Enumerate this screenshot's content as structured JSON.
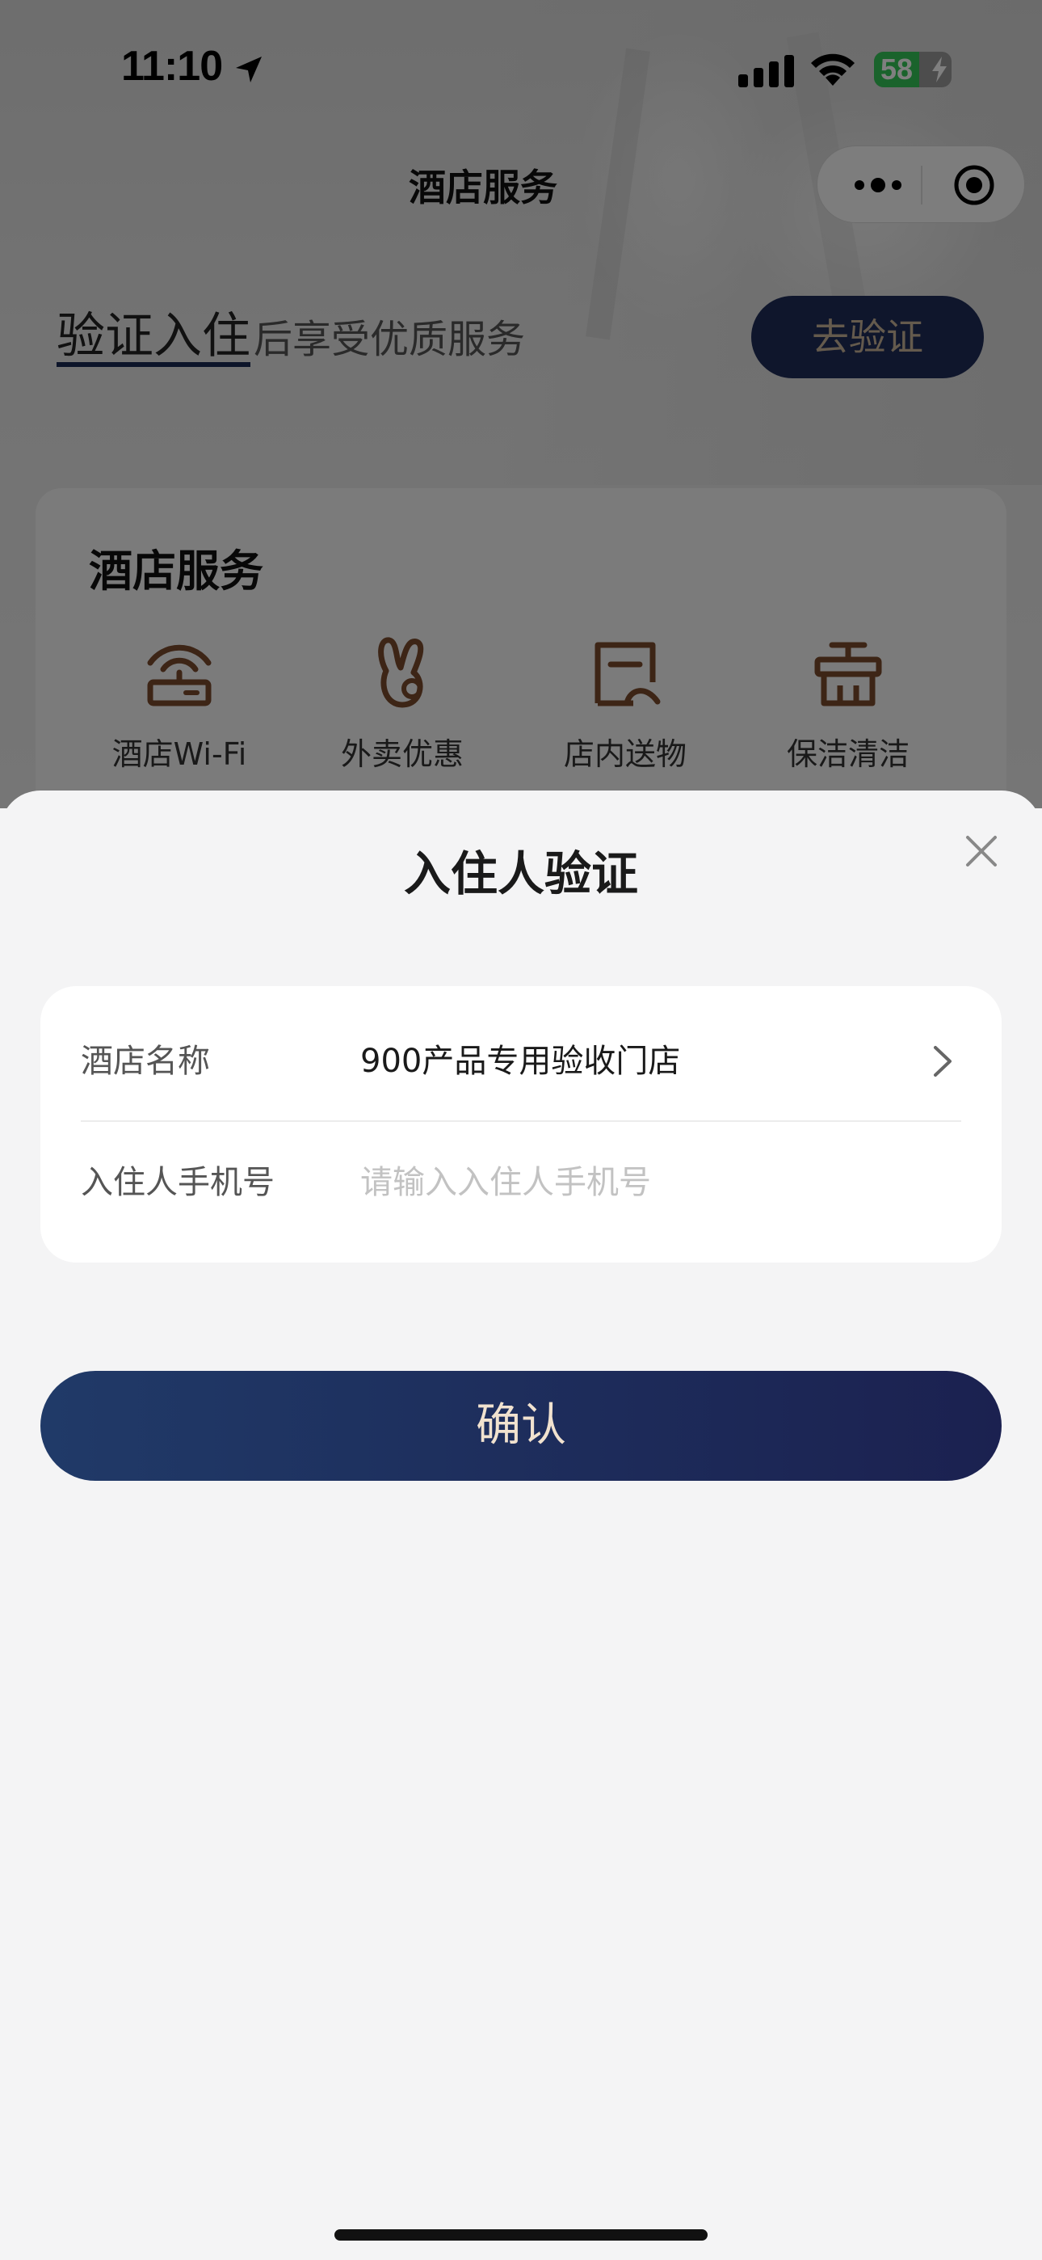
{
  "status_bar": {
    "time": "11:10",
    "battery": "58",
    "battery_level": 0.58,
    "icons": [
      "location-arrow-icon",
      "cellular-signal-icon",
      "wifi-icon",
      "battery-icon",
      "charging-bolt-icon"
    ]
  },
  "nav": {
    "title": "酒店服务",
    "capsule_icons": [
      "more-dots-icon",
      "close-target-icon"
    ]
  },
  "verify_banner": {
    "strong": "验证入住",
    "rest": "后享受优质服务",
    "button": "去验证"
  },
  "services": {
    "title": "酒店服务",
    "items": [
      {
        "label": "酒店Wi-Fi",
        "icon": "wifi-router-icon"
      },
      {
        "label": "外卖优惠",
        "icon": "rabbit-icon"
      },
      {
        "label": "店内送物",
        "icon": "delivery-box-icon"
      },
      {
        "label": "保洁清洁",
        "icon": "cleaning-basket-icon"
      }
    ]
  },
  "sheet": {
    "title": "入住人验证",
    "close_icon": "close-icon",
    "hotel_label": "酒店名称",
    "hotel_value": "900产品专用验收门店",
    "phone_label": "入住人手机号",
    "phone_placeholder": "请输入入住人手机号",
    "phone_value": "",
    "confirm": "确认"
  },
  "colors": {
    "accent_navy": "#1e2d58",
    "button_text_gold": "#f1e2cf",
    "icon_brown": "#7a4a2c",
    "battery_green": "#34c759"
  }
}
